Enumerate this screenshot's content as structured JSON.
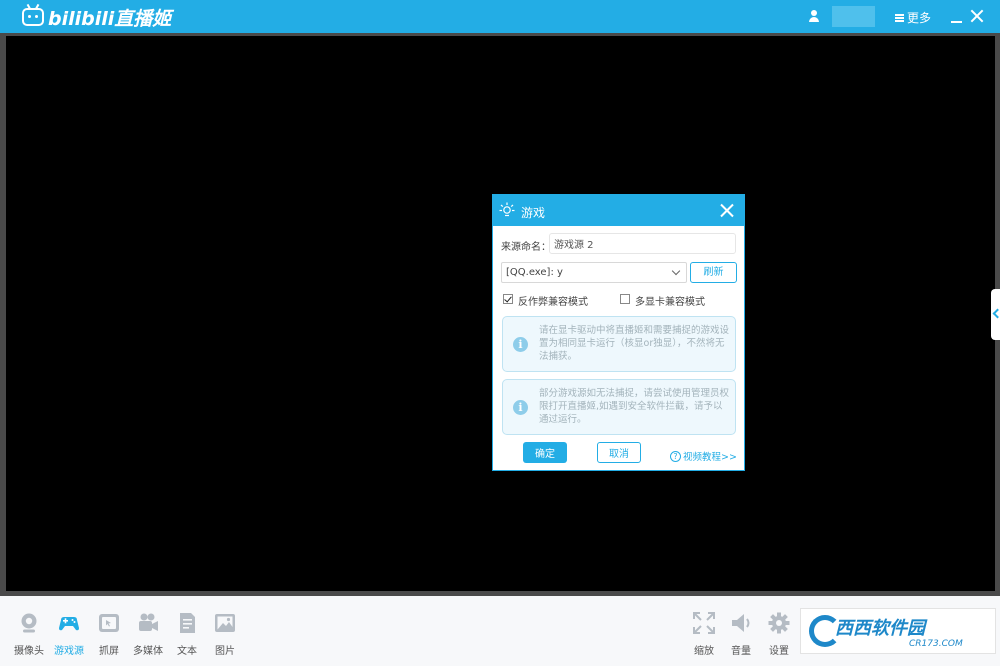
{
  "titlebar": {
    "logo_text": "bilibili直播姬",
    "more_label": "更多"
  },
  "dialog": {
    "title": "游戏",
    "source_name_label": "来源命名：",
    "source_name_value": "游戏源 2",
    "process_value": "[QQ.exe]: y",
    "refresh_label": "刷新",
    "anti_cheat_label": "反作弊兼容模式",
    "anti_cheat_checked": true,
    "multi_gpu_label": "多显卡兼容模式",
    "multi_gpu_checked": false,
    "info1": "请在显卡驱动中将直播姬和需要捕捉的游戏设置为相同显卡运行（核显or独显），不然将无法捕获。",
    "info2": "部分游戏源如无法捕捉，请尝试使用管理员权限打开直播姬,如遇到安全软件拦截，请予以通过运行。",
    "ok_label": "确定",
    "cancel_label": "取消",
    "tutorial_label": "视频教程>>"
  },
  "toolbar": {
    "left_tools": [
      {
        "label": "摄像头",
        "icon": "camera-icon"
      },
      {
        "label": "游戏源",
        "icon": "gamepad-icon"
      },
      {
        "label": "抓屏",
        "icon": "screen-capture-icon"
      },
      {
        "label": "多媒体",
        "icon": "media-icon"
      },
      {
        "label": "文本",
        "icon": "text-icon"
      },
      {
        "label": "图片",
        "icon": "image-icon"
      }
    ],
    "right_tools": [
      {
        "label": "缩放",
        "icon": "zoom-icon"
      },
      {
        "label": "音量",
        "icon": "volume-icon"
      },
      {
        "label": "设置",
        "icon": "settings-gear-icon"
      }
    ],
    "watermark_text": "西西软件园",
    "watermark_sub": "CR173.COM"
  },
  "colors": {
    "accent": "#23ade5",
    "preview_bg": "#000000",
    "frame": "#4a4a4a",
    "toolbar_bg": "#f7f8fa",
    "active_tool": "#23ade5",
    "inactive_tool": "#b5bcc4"
  }
}
